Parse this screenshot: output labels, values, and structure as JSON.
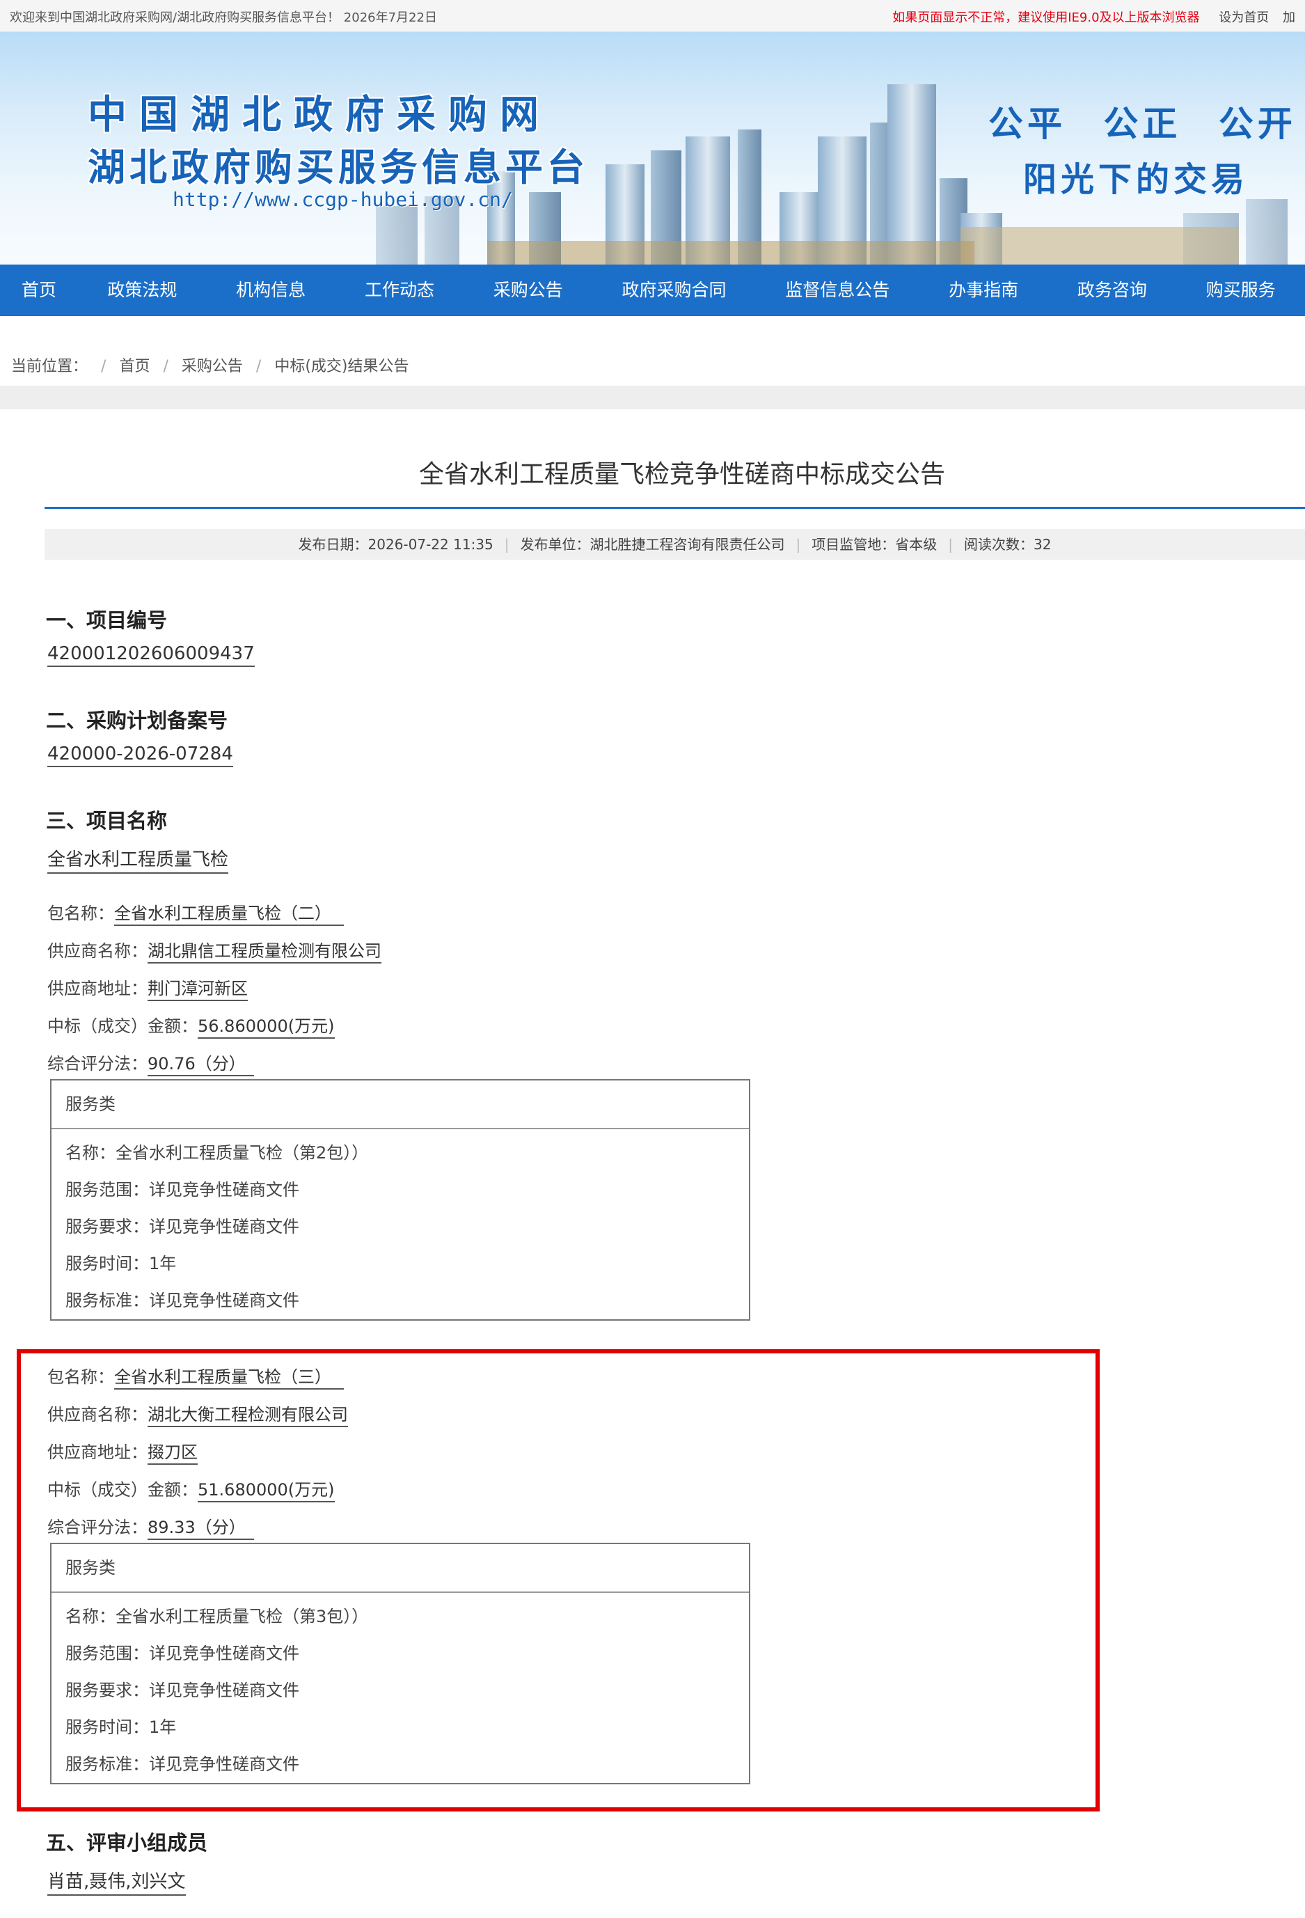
{
  "topbar": {
    "welcome": "欢迎来到中国湖北政府采购网/湖北政府购买服务信息平台！ 2026年7月22日",
    "warning": "如果页面显示不正常，建议使用IE9.0及以上版本浏览器",
    "set_home": "设为首页",
    "add_fav": "加"
  },
  "banner": {
    "title_line1": "中国湖北政府采购网",
    "title_line2": "湖北政府购买服务信息平台",
    "url": "http://www.ccgp-hubei.gov.cn/",
    "slogan_line1": "公平 公正 公开",
    "slogan_line2": "阳光下的交易"
  },
  "nav": {
    "items": [
      "首页",
      "政策法规",
      "机构信息",
      "工作动态",
      "采购公告",
      "政府采购合同",
      "监督信息公告",
      "办事指南",
      "政务咨询",
      "购买服务"
    ]
  },
  "breadcrumb": {
    "label": "当前位置：",
    "items": [
      "首页",
      "采购公告",
      "中标(成交)结果公告"
    ]
  },
  "article": {
    "title": "全省水利工程质量飞检竞争性磋商中标成交公告",
    "meta": {
      "publish_date": "发布日期：2026-07-22 11:35",
      "publisher": "发布单位：湖北胜捷工程咨询有限责任公司",
      "region": "项目监管地：省本级",
      "views": "阅读次数：32"
    },
    "sections": {
      "s1": {
        "heading": "一、项目编号",
        "value": "420001202606009437"
      },
      "s2": {
        "heading": "二、采购计划备案号",
        "value": "420000-2026-07284"
      },
      "s3": {
        "heading": "三、项目名称",
        "value": "全省水利工程质量飞检"
      },
      "s5": {
        "heading": "五、评审小组成员",
        "value": "肖苗,聂伟,刘兴文"
      }
    },
    "packages": [
      {
        "pkg_label": "包名称：",
        "pkg_value": "全省水利工程质量飞检（二）",
        "supplier_label": "供应商名称：",
        "supplier_value": "湖北鼎信工程质量检测有限公司",
        "address_label": "供应商地址：",
        "address_value": "荆门漳河新区",
        "amount_label": "中标（成交）金额：",
        "amount_value": "56.860000(万元)",
        "score_label": "综合评分法：",
        "score_value": "90.76（分）",
        "service": {
          "head": "服务类",
          "rows": [
            "名称：全省水利工程质量飞检（第2包））",
            "服务范围：详见竞争性磋商文件",
            "服务要求：详见竞争性磋商文件",
            "服务时间：1年",
            "服务标准：详见竞争性磋商文件"
          ]
        }
      },
      {
        "pkg_label": "包名称：",
        "pkg_value": "全省水利工程质量飞检（三）",
        "supplier_label": "供应商名称：",
        "supplier_value": "湖北大衡工程检测有限公司",
        "address_label": "供应商地址：",
        "address_value": "掇刀区",
        "amount_label": "中标（成交）金额：",
        "amount_value": "51.680000(万元)",
        "score_label": "综合评分法：",
        "score_value": "89.33（分）",
        "service": {
          "head": "服务类",
          "rows": [
            "名称：全省水利工程质量飞检（第3包））",
            "服务范围：详见竞争性磋商文件",
            "服务要求：详见竞争性磋商文件",
            "服务时间：1年",
            "服务标准：详见竞争性磋商文件"
          ]
        }
      }
    ]
  },
  "colors": {
    "brand_blue": "#1c6fc8",
    "warning_red": "#e60012",
    "highlight_red": "#e00000"
  }
}
